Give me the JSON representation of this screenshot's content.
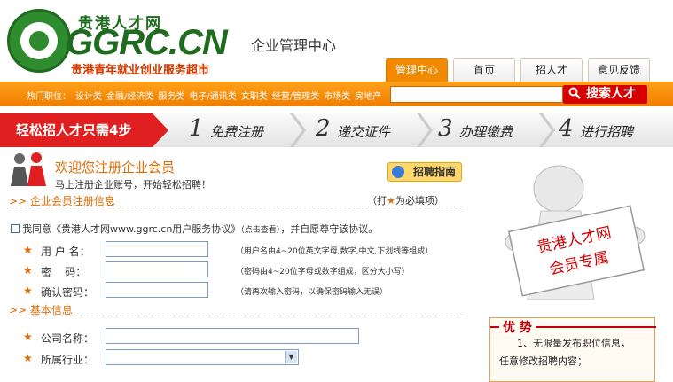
{
  "header": {
    "logo_cn": "贵港人才网",
    "logo_en": "GGRC.CN",
    "slogan": "贵港青年就业创业服务超市",
    "subtitle": "企业管理中心"
  },
  "nav": {
    "tabs": [
      {
        "label": "管理中心",
        "active": true
      },
      {
        "label": "首页",
        "active": false
      },
      {
        "label": "招人才",
        "active": false
      },
      {
        "label": "意见反馈",
        "active": false
      }
    ]
  },
  "hotbar": {
    "label": "热门职位：",
    "links": [
      "设计类",
      "金融/经济类",
      "服务类",
      "电子/通讯类",
      "文职类",
      "经营/管理类",
      "市场类",
      "房地产"
    ],
    "search_placeholder": "",
    "search_button": "搜索人才"
  },
  "steps": {
    "intro": "轻松招人才只需4步",
    "items": [
      {
        "num": "1",
        "label": "免费注册"
      },
      {
        "num": "2",
        "label": "递交证件"
      },
      {
        "num": "3",
        "label": "办理缴费"
      },
      {
        "num": "4",
        "label": "进行招聘"
      }
    ]
  },
  "welcome": {
    "title": "欢迎您注册企业会员",
    "subtitle": "马上注册企业账号，开始轻松招聘！",
    "guide_button": "招聘指南"
  },
  "register_section": {
    "title": ">> 企业会员注册信息",
    "required_note_open": "（打",
    "required_note_star": "★",
    "required_note_close": "为必填项）"
  },
  "agreement": {
    "text": "我同意《贵港人才网www.ggrc.cn用户服务协议》",
    "hint": "（点击查看）",
    "suffix": "，并自愿尊守该协议。",
    "checked": false
  },
  "fields": {
    "username": {
      "star": "★",
      "label": "用 户 名：",
      "value": "",
      "hint": "（用户名由4~20位英文字母,数字,中文,下划线等组成）"
    },
    "password": {
      "star": "★",
      "label": "密    码：",
      "value": "",
      "hint": "（密码由4~20位字母或数字组成，区分大小写）"
    },
    "confirm": {
      "star": "★",
      "label": "确认密码：",
      "value": "",
      "hint": "（请再次输入密码，以确保密码输入无误）"
    }
  },
  "basic_section": {
    "title": ">> 基本信息"
  },
  "basic_fields": {
    "company": {
      "star": "★",
      "label": "公司名称：",
      "value": ""
    },
    "industry": {
      "star": "★",
      "label": "所属行业：",
      "value": ""
    }
  },
  "sidebar": {
    "sign_line1": "贵港人才网",
    "sign_line2": "会员专属",
    "adv_title": "优 势",
    "adv_line1": "1、无限量发布职位信息，",
    "adv_line2": "任意修改招聘内容；"
  },
  "colors": {
    "accent_orange": "#f07d00",
    "brand_green": "#1f6b1f",
    "step_red": "#e02020"
  }
}
